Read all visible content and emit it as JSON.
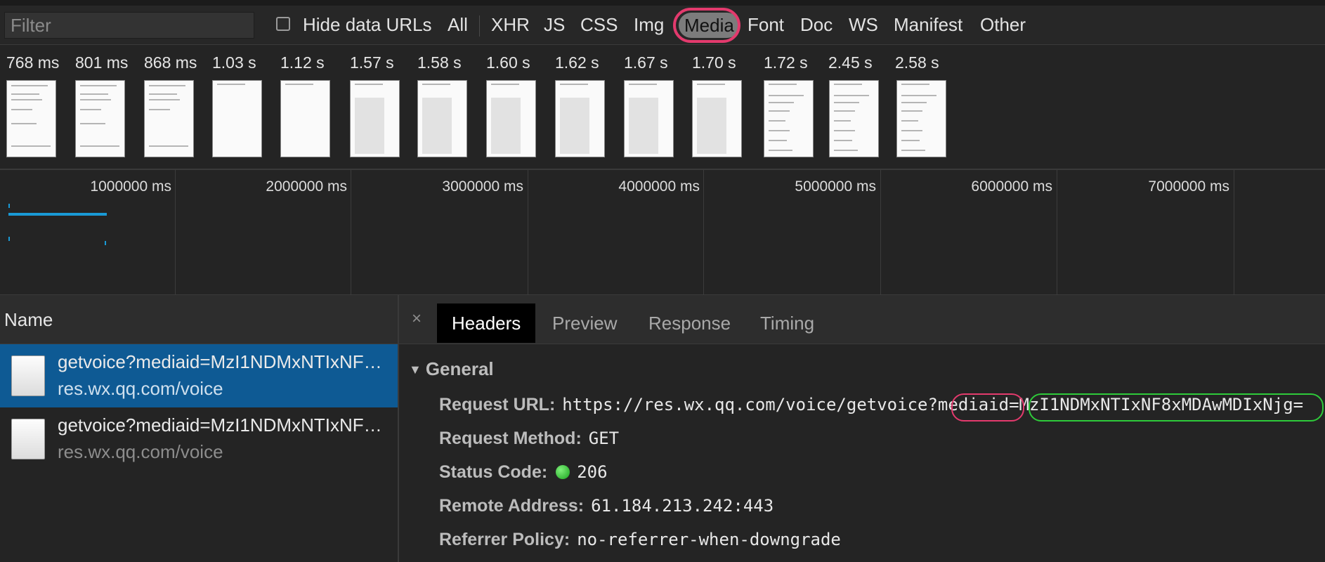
{
  "toolbar": {
    "filter_placeholder": "Filter",
    "hide_data_urls_label": "Hide data URLs",
    "filter_types": [
      "All",
      "XHR",
      "JS",
      "CSS",
      "Img",
      "Media",
      "Font",
      "Doc",
      "WS",
      "Manifest",
      "Other"
    ],
    "active_filter": "Media",
    "highlight_color": "#e33a6d"
  },
  "filmstrip": {
    "times": [
      "768 ms",
      "801 ms",
      "868 ms",
      "1.03 s",
      "1.12 s",
      "1.57 s",
      "1.58 s",
      "1.60 s",
      "1.62 s",
      "1.67 s",
      "1.70 s",
      "1.72 s",
      "2.45 s",
      "2.58 s"
    ]
  },
  "overview": {
    "ticks": [
      "1000000 ms",
      "2000000 ms",
      "3000000 ms",
      "4000000 ms",
      "5000000 ms",
      "6000000 ms",
      "7000000 ms"
    ],
    "bar_color": "#199ad6"
  },
  "requests": {
    "header": "Name",
    "rows": [
      {
        "name": "getvoice?mediaid=MzI1NDMxNTIxNF…",
        "domain": "res.wx.qq.com/voice",
        "selected": true
      },
      {
        "name": "getvoice?mediaid=MzI1NDMxNTIxNF…",
        "domain": "res.wx.qq.com/voice",
        "selected": false
      }
    ]
  },
  "detail": {
    "close": "×",
    "tabs": [
      "Headers",
      "Preview",
      "Response",
      "Timing"
    ],
    "active_tab": "Headers",
    "section": "General",
    "fields": {
      "request_url_label": "Request URL:",
      "request_url_value": "https://res.wx.qq.com/voice/getvoice?mediaid=MzI1NDMxNTIxNF8xMDAwMDIxNjg=",
      "method_label": "Request Method:",
      "method_value": "GET",
      "status_label": "Status Code:",
      "status_value": "206",
      "status_color": "#19a31e",
      "remote_label": "Remote Address:",
      "remote_value": "61.184.213.242:443",
      "referrer_label": "Referrer Policy:",
      "referrer_value": "no-referrer-when-downgrade"
    },
    "annotation_colors": {
      "param": "#e33a6d",
      "value": "#2ecb3a"
    }
  }
}
